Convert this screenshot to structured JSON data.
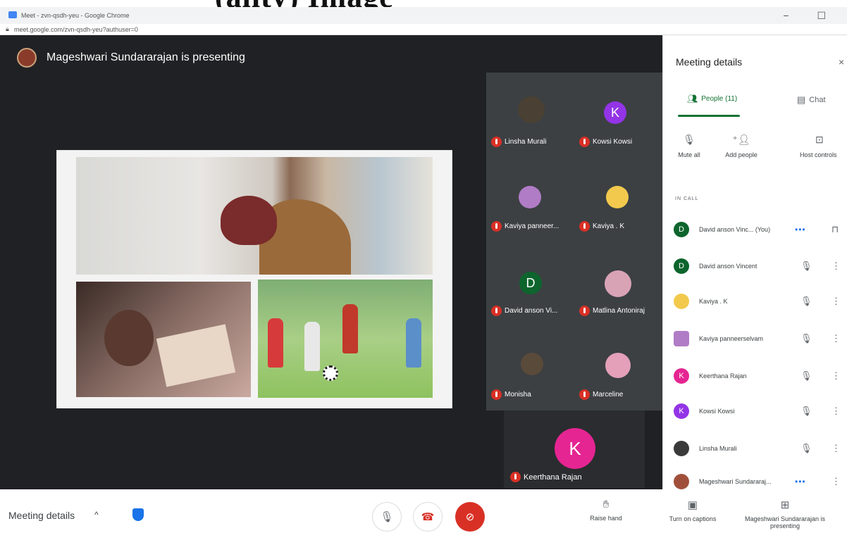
{
  "overlay": {
    "heading": "(ality) Image"
  },
  "browser": {
    "title": "Meet - zvn-qsdh-yeu - Google Chrome",
    "url": "meet.google.com/zvn-qsdh-yeu?authuser=0",
    "window_buttons": "− ☐"
  },
  "stage": {
    "presenter": "Mageshwari Sundararajan is presenting"
  },
  "tiles": [
    {
      "name": "Linsha Murali",
      "avatar": ""
    },
    {
      "name": "Kowsi Kowsi",
      "avatar": "K",
      "color": "#9334e6"
    },
    {
      "name": "Kaviya panneer...",
      "avatar": ""
    },
    {
      "name": "Kaviya . K",
      "avatar": ""
    },
    {
      "name": "David anson Vi...",
      "avatar": "D",
      "color": "#0d652d"
    },
    {
      "name": "Matlina Antoniraj",
      "avatar": ""
    },
    {
      "name": "Monisha",
      "avatar": ""
    },
    {
      "name": "Marceline",
      "avatar": ""
    }
  ],
  "big_tile": {
    "name": "Keerthana Rajan",
    "avatar": "K",
    "color": "#e52592"
  },
  "panel": {
    "title": "Meeting details",
    "close": "×",
    "tab_people": "People (11)",
    "tab_chat": "Chat",
    "actions": {
      "mute_all": "Mute all",
      "add_people": "Add people",
      "host_controls": "Host controls"
    },
    "in_call": "IN CALL",
    "people": [
      {
        "name": "David anson Vinc...  (You)",
        "avatar": "D",
        "color": "#0d652d"
      },
      {
        "name": "David anson Vincent",
        "avatar": "D",
        "color": "#0d652d"
      },
      {
        "name": "Kaviya . K",
        "avatar": "",
        "color": "#f2c94c"
      },
      {
        "name": "Kaviya panneerselvam",
        "avatar": "",
        "color": "#b07cc6"
      },
      {
        "name": "Keerthana Rajan",
        "avatar": "K",
        "color": "#e52592"
      },
      {
        "name": "Kowsi Kowsi",
        "avatar": "K",
        "color": "#9334e6"
      },
      {
        "name": "Linsha Murali",
        "avatar": "",
        "color": "#3a3a3a"
      },
      {
        "name": "Mageshwari Sundararaj...",
        "avatar": "",
        "color": "#a0503a"
      }
    ]
  },
  "bottom": {
    "meeting_details": "Meeting details",
    "chevron": "^",
    "raise_hand": "Raise hand",
    "captions": "Turn on captions",
    "presenting": "Mageshwari Sundararajan is presenting"
  }
}
